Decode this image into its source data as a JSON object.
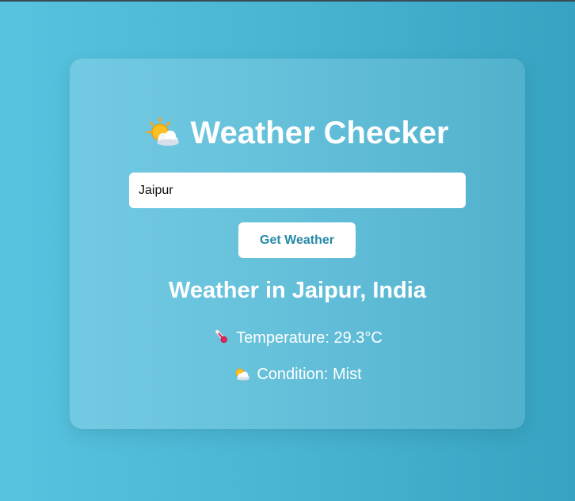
{
  "app": {
    "title": "Weather Checker",
    "title_icon": "sun-behind-cloud-icon"
  },
  "search": {
    "value": "Jaipur",
    "button_label": "Get Weather"
  },
  "result": {
    "heading": "Weather in Jaipur, India",
    "temperature_text": "Temperature: 29.3°C",
    "temperature_icon": "thermometer-icon",
    "condition_text": "Condition: Mist",
    "condition_icon": "sun-behind-cloud-icon"
  },
  "colors": {
    "background_left": "#57c3df",
    "background_right": "#36a3c2",
    "button_text": "#2489a6",
    "text": "#ffffff"
  }
}
